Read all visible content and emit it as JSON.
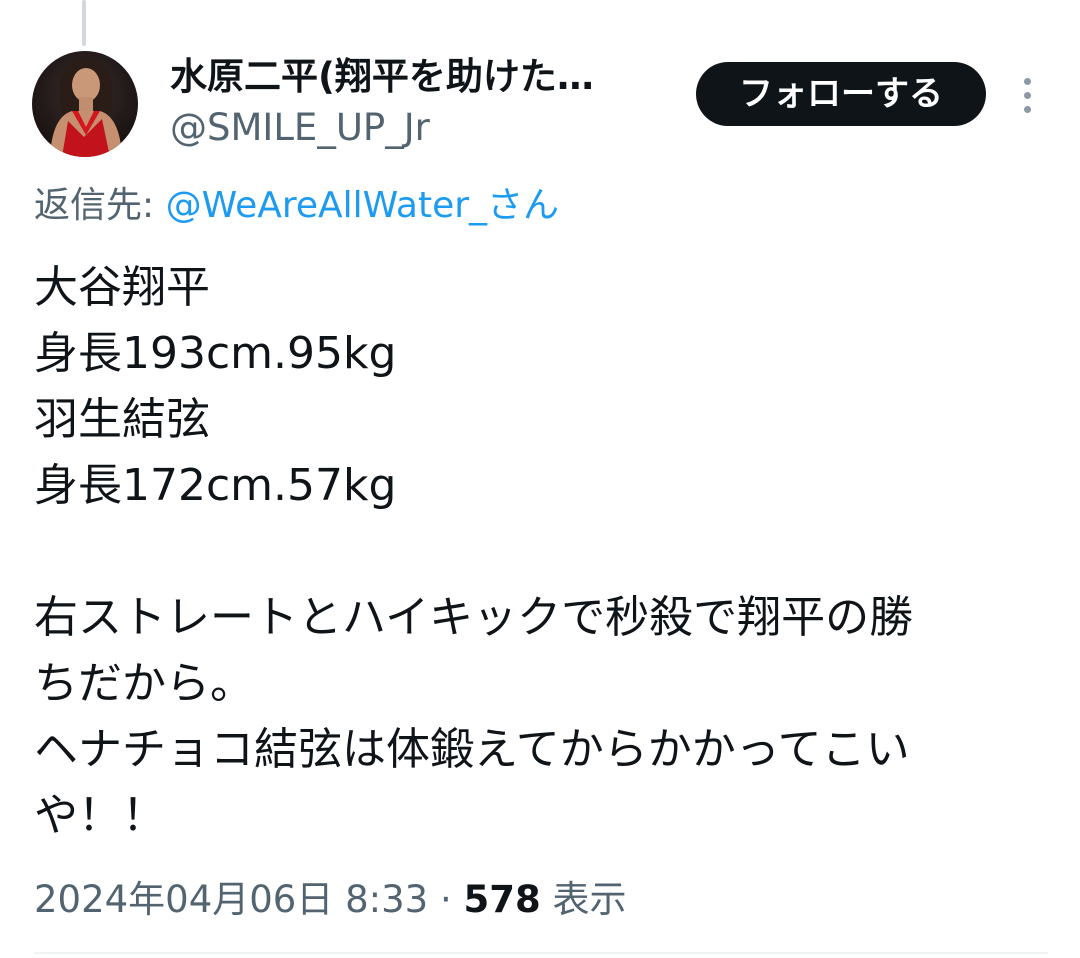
{
  "tweet": {
    "author": {
      "display_name": "水原二平(翔平を助けた…",
      "handle": "@SMILE_UP_Jr",
      "avatar_icon": "user-avatar-photo"
    },
    "follow_label": "フォローする",
    "more_icon": "more-vertical-icon",
    "reply_to": {
      "prefix": "返信先: ",
      "mention": "@WeAreAllWater_さん"
    },
    "body_lines": [
      "大谷翔平",
      "身長193cm.95kg",
      "羽生結弦",
      "身長172cm.57kg",
      "",
      "右ストレートとハイキックで秒殺で翔平の勝",
      "ちだから。",
      "ヘナチョコ結弦は体鍛えてからかかってこい",
      "や！！"
    ],
    "timestamp": "2024年04月06日 8:33",
    "separator": " · ",
    "view_count": "578",
    "view_label": " 表示"
  },
  "colors": {
    "text_primary": "#0f1419",
    "text_secondary": "#536471",
    "link": "#1d9bf0",
    "button_bg": "#0f1419",
    "button_text": "#ffffff"
  }
}
